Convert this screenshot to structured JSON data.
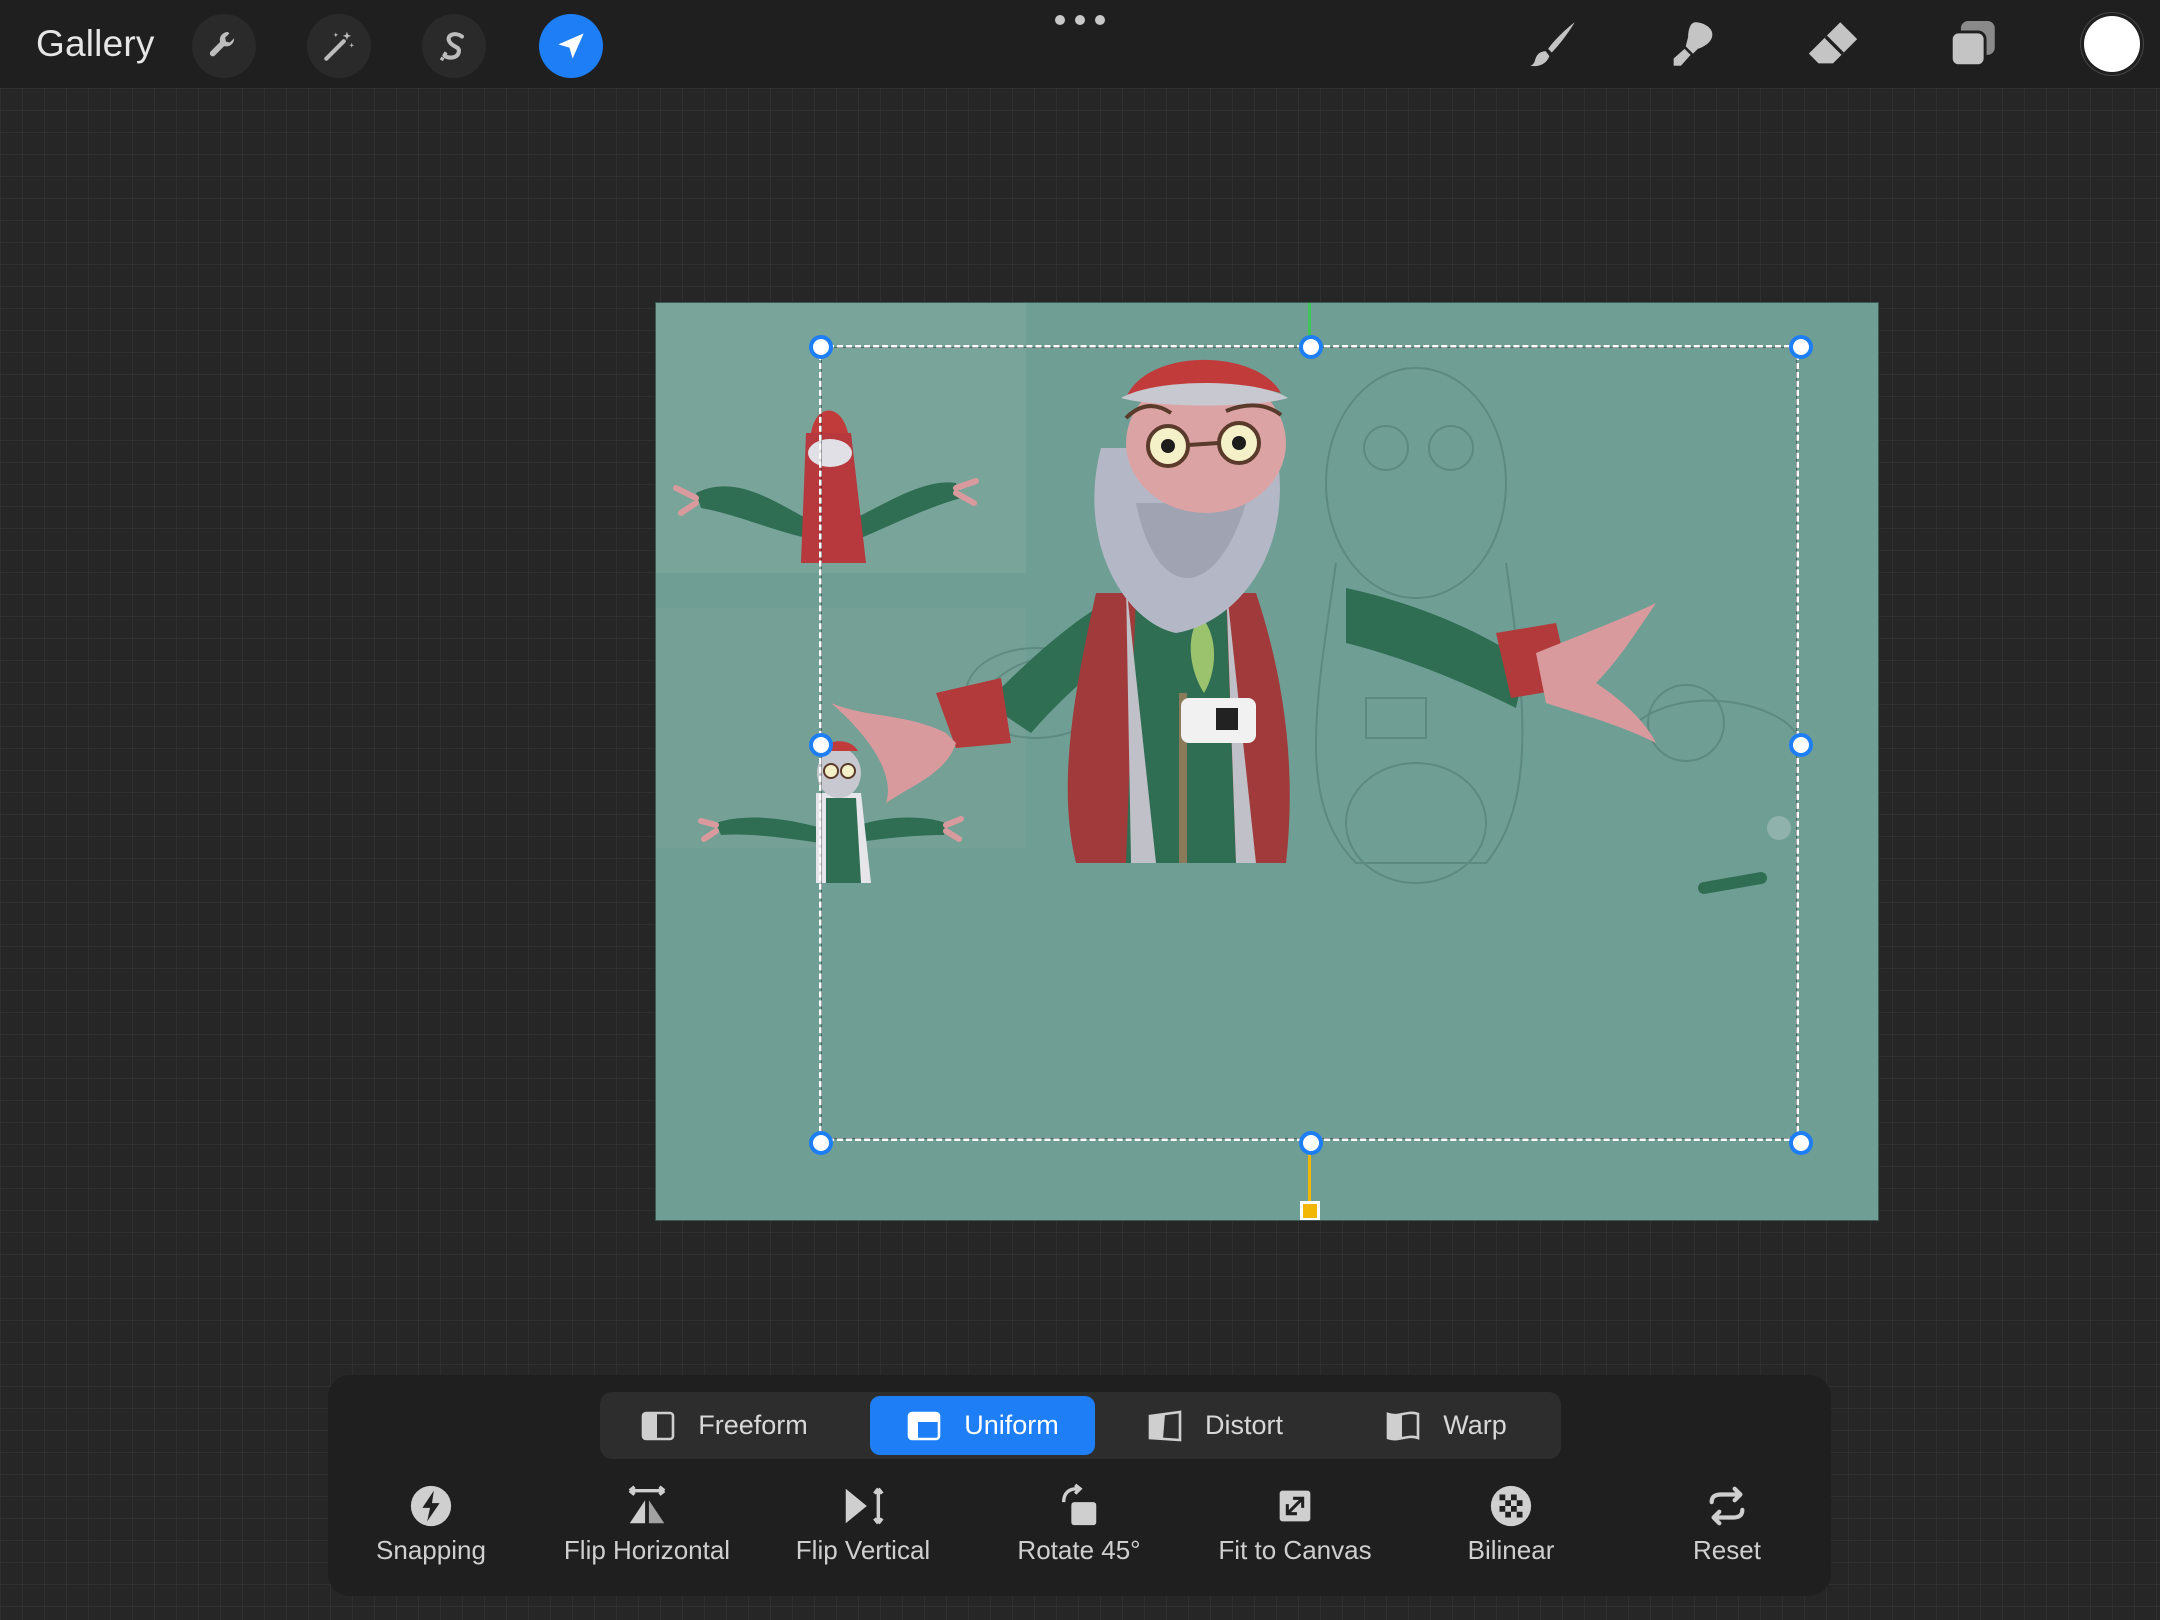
{
  "topbar": {
    "gallery_label": "Gallery",
    "left_tools": [
      {
        "name": "actions",
        "icon": "wrench-icon",
        "active": false
      },
      {
        "name": "adjustments",
        "icon": "magic-wand-icon",
        "active": false
      },
      {
        "name": "selection",
        "icon": "selection-s-icon",
        "active": false
      },
      {
        "name": "transform",
        "icon": "transform-arrow-icon",
        "active": true
      }
    ],
    "right_tools": [
      {
        "name": "brush",
        "icon": "brush-icon"
      },
      {
        "name": "smudge",
        "icon": "smudge-icon"
      },
      {
        "name": "eraser",
        "icon": "eraser-icon"
      },
      {
        "name": "layers",
        "icon": "layers-icon"
      }
    ],
    "current_color": "#ffffff"
  },
  "colors": {
    "accent": "#1d7ef5",
    "canvas_bg": "#6f9e94",
    "rotation_handle": "#3ec45b",
    "shear_handle": "#f2b705"
  },
  "transform": {
    "modes": [
      {
        "label": "Freeform",
        "icon": "freeform-icon",
        "active": false
      },
      {
        "label": "Uniform",
        "icon": "uniform-icon",
        "active": true
      },
      {
        "label": "Distort",
        "icon": "distort-icon",
        "active": false
      },
      {
        "label": "Warp",
        "icon": "warp-icon",
        "active": false
      }
    ],
    "tools": [
      {
        "label": "Snapping",
        "icon": "lightning-icon"
      },
      {
        "label": "Flip Horizontal",
        "icon": "flip-horizontal-icon"
      },
      {
        "label": "Flip Vertical",
        "icon": "flip-vertical-icon"
      },
      {
        "label": "Rotate 45°",
        "icon": "rotate-icon"
      },
      {
        "label": "Fit to Canvas",
        "icon": "fit-to-canvas-icon"
      },
      {
        "label": "Bilinear",
        "icon": "bilinear-icon"
      },
      {
        "label": "Reset",
        "icon": "reset-icon"
      }
    ]
  }
}
